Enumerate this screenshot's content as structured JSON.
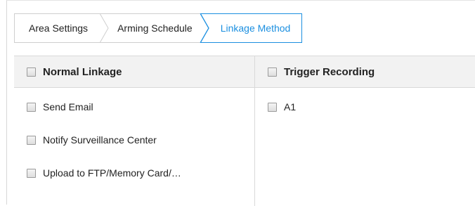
{
  "tabs": [
    {
      "label": "Area Settings",
      "active": false
    },
    {
      "label": "Arming Schedule",
      "active": false
    },
    {
      "label": "Linkage Method",
      "active": true
    }
  ],
  "table": {
    "columns": [
      {
        "label": "Normal Linkage",
        "checked": false
      },
      {
        "label": "Trigger Recording",
        "checked": false
      }
    ],
    "normal_linkage_items": [
      {
        "label": "Send Email",
        "checked": false
      },
      {
        "label": "Notify Surveillance Center",
        "checked": false
      },
      {
        "label": "Upload to FTP/Memory Card/…",
        "checked": false
      }
    ],
    "trigger_recording_items": [
      {
        "label": "A1",
        "checked": false
      }
    ]
  },
  "colors": {
    "accent": "#1b8fe0",
    "header_bg": "#f2f2f2",
    "border": "#d9d9d9"
  }
}
